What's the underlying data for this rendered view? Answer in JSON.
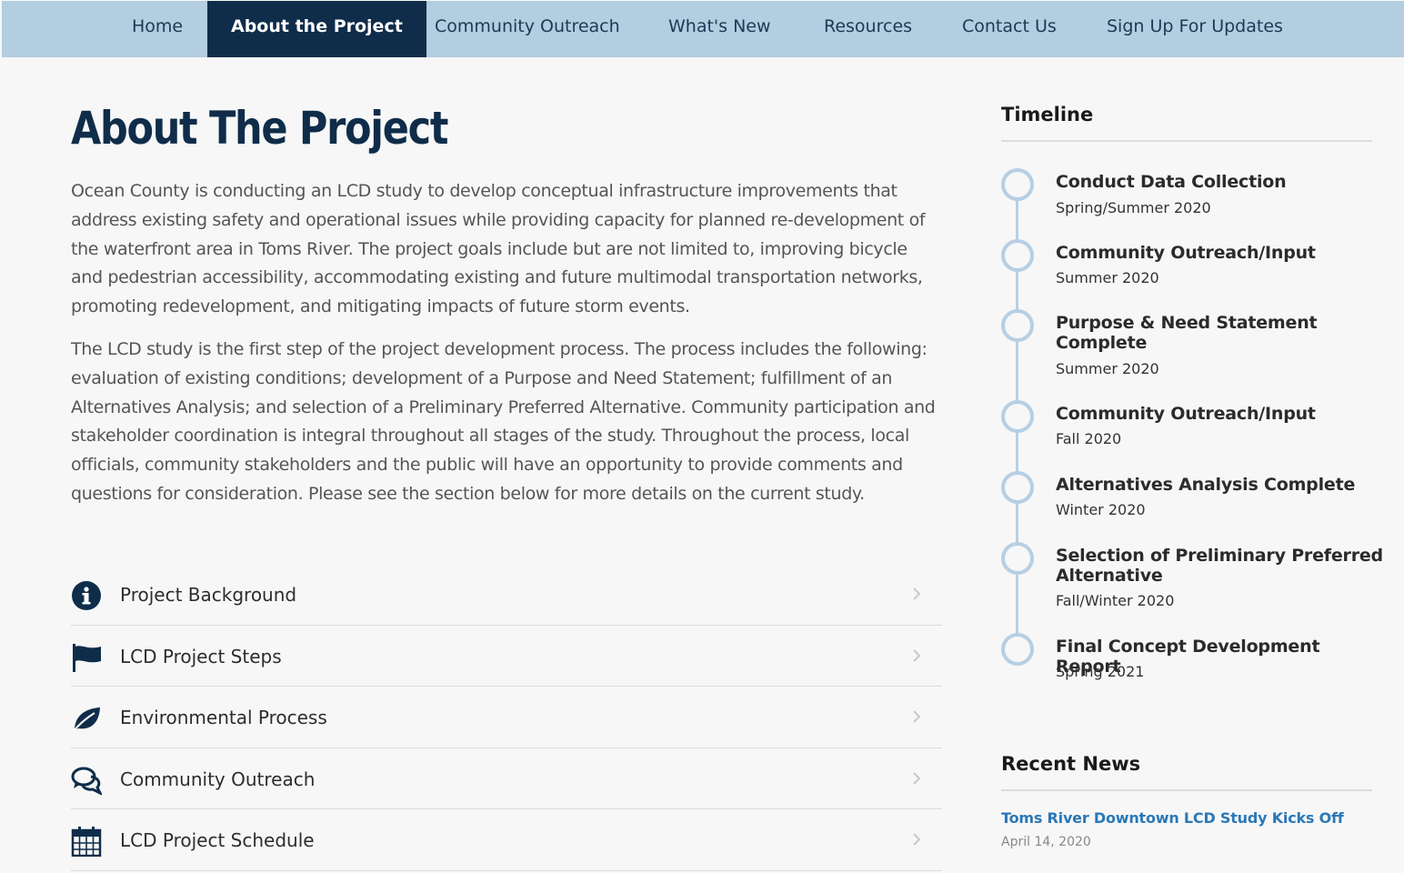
{
  "nav": {
    "items": [
      {
        "label": "Home",
        "active": false
      },
      {
        "label": "About the Project",
        "active": true
      },
      {
        "label": "Community Outreach",
        "active": false
      },
      {
        "label": "What's New",
        "active": false
      },
      {
        "label": "Resources",
        "active": false
      },
      {
        "label": "Contact Us",
        "active": false
      },
      {
        "label": "Sign Up For Updates",
        "active": false
      }
    ]
  },
  "main": {
    "title": "About The Project",
    "paragraphs": [
      "Ocean County is conducting an LCD study to develop conceptual infrastructure improvements that address existing safety and operational issues while providing capacity for planned re-development of the waterfront area in Toms River. The project goals include but are not limited to, improving bicycle and pedestrian accessibility, accommodating existing and future multimodal transportation networks, promoting redevelopment, and mitigating impacts of future storm events.",
      "The LCD study is the first step of the project development process. The process includes the following: evaluation of existing conditions; development of a Purpose and Need Statement; fulfillment of an Alternatives Analysis; and selection of a Preliminary Preferred Alternative. Community participation and stakeholder coordination is integral throughout all stages of the study. Throughout the process, local officials, community stakeholders and the public will have an opportunity to provide comments and questions for consideration. Please see the section below for more details on the current study."
    ],
    "accordion": [
      {
        "label": "Project Background",
        "icon": "info-icon"
      },
      {
        "label": "LCD Project Steps",
        "icon": "flag-icon"
      },
      {
        "label": "Environmental Process",
        "icon": "leaf-icon"
      },
      {
        "label": "Community Outreach",
        "icon": "chat-bubbles-icon"
      },
      {
        "label": "LCD Project Schedule",
        "icon": "calendar-icon"
      }
    ]
  },
  "sidebar": {
    "timeline_title": "Timeline",
    "timeline": [
      {
        "title": "Conduct Data Collection",
        "date": "Spring/Summer 2020"
      },
      {
        "title": "Community Outreach/Input",
        "date": "Summer 2020"
      },
      {
        "title": "Purpose & Need Statement Complete",
        "date": "Summer 2020"
      },
      {
        "title": "Community Outreach/Input",
        "date": "Fall 2020"
      },
      {
        "title": "Alternatives Analysis Complete",
        "date": "Winter 2020"
      },
      {
        "title": "Selection of Preliminary Preferred Alternative",
        "date": "Fall/Winter 2020"
      },
      {
        "title": "Final Concept Development Report",
        "date": "Spring 2021"
      }
    ],
    "news_title": "Recent News",
    "news": [
      {
        "title": "Toms River Downtown LCD Study Kicks Off",
        "date": "April 14, 2020"
      }
    ]
  },
  "colors": {
    "nav_bg": "#b3cde1",
    "nav_active_bg": "#0f2d4a",
    "title": "#0f2d4a",
    "timeline_accent": "#b7cfe3",
    "link": "#2b78b8"
  }
}
